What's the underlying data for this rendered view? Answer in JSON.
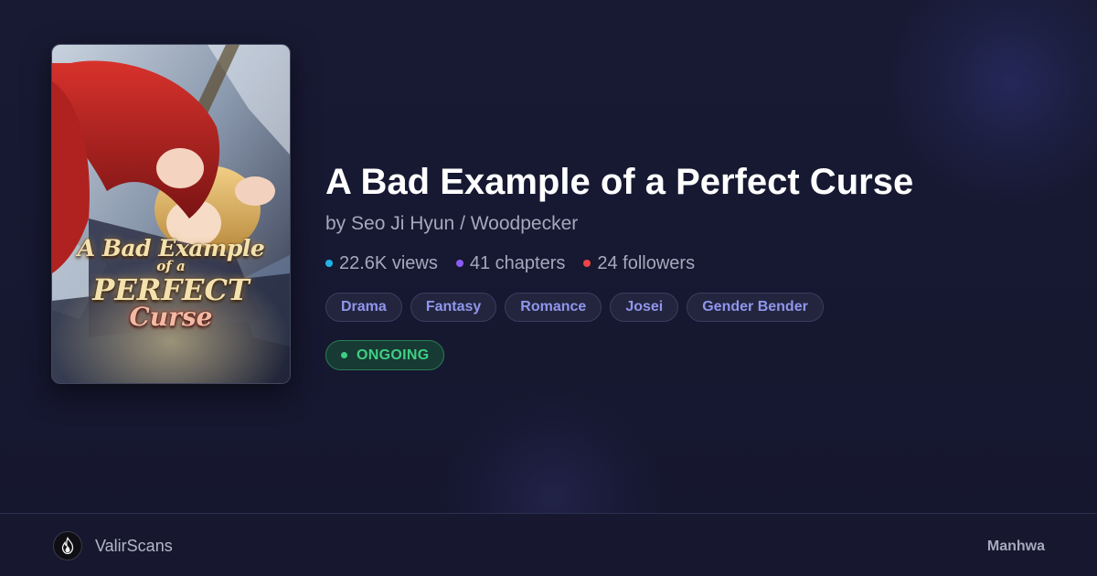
{
  "series": {
    "title": "A Bad Example of a Perfect Curse",
    "author": "by Seo Ji Hyun / Woodpecker",
    "cover_title_lines": [
      "A Bad Example",
      "of a",
      "PERFECT",
      "Curse"
    ]
  },
  "stats": [
    {
      "label": "22.6K views",
      "color": "#22b3e6"
    },
    {
      "label": "41 chapters",
      "color": "#8b5cf6"
    },
    {
      "label": "24 followers",
      "color": "#ef4444"
    }
  ],
  "genres": [
    "Drama",
    "Fantasy",
    "Romance",
    "Josei",
    "Gender Bender"
  ],
  "status": {
    "label": "ONGOING",
    "color": "#3fcf83"
  },
  "footer": {
    "site_name": "ValirScans",
    "logo_icon": "flame-icon",
    "type": "Manhwa"
  },
  "colors": {
    "background": "#16172f",
    "tag_text": "#8f96ec",
    "title": "#ffffff"
  }
}
